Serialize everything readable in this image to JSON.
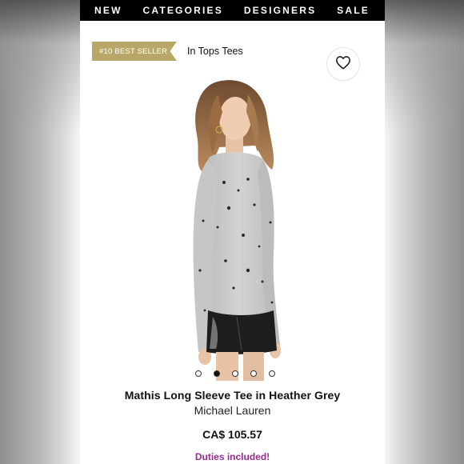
{
  "nav": {
    "items": [
      "NEW",
      "CATEGORIES",
      "DESIGNERS",
      "SALE"
    ]
  },
  "badge": {
    "label": "#10 BEST SELLER",
    "color": "#b9a76a"
  },
  "category_text": "In Tops Tees",
  "favorite": {
    "icon": "heart-icon"
  },
  "gallery": {
    "image_count": 5,
    "active_index": 1
  },
  "product": {
    "title": "Mathis Long Sleeve Tee in Heather Grey",
    "brand": "Michael Lauren",
    "price": "CA$ 105.57",
    "duties_note": "Duties included!",
    "duties_color": "#9b2a8f"
  }
}
